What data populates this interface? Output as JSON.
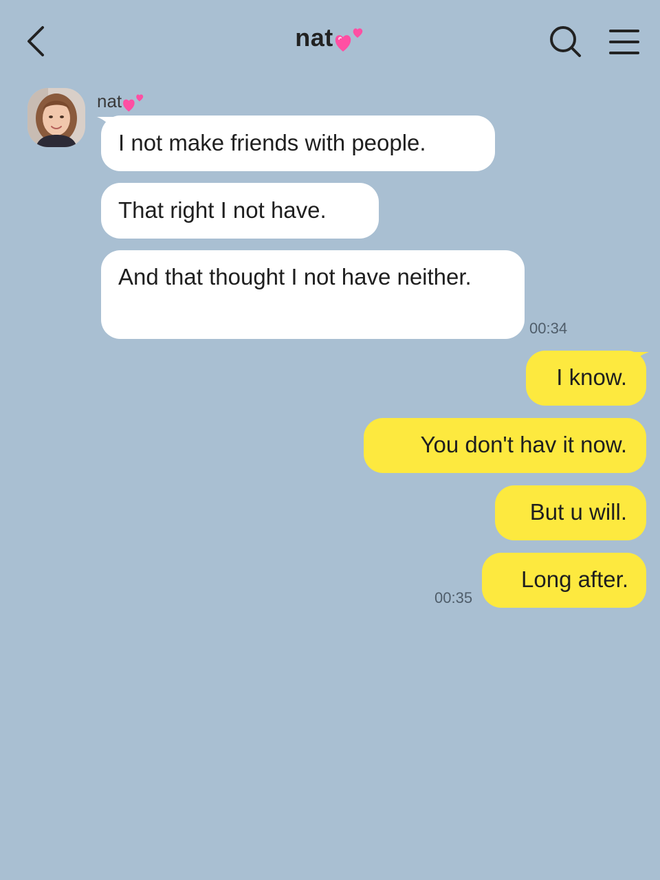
{
  "header": {
    "title": "nat",
    "title_emoji": "two-hearts-icon"
  },
  "contact": {
    "name": "nat",
    "name_emoji": "two-hearts-icon"
  },
  "messages": [
    {
      "direction": "incoming",
      "text": "I not make friends with people."
    },
    {
      "direction": "incoming",
      "text": "That right I not have."
    },
    {
      "direction": "incoming",
      "text": "And that thought I not have neither."
    },
    {
      "direction": "outgoing",
      "text": "I know."
    },
    {
      "direction": "outgoing",
      "text": "You don't hav it now."
    },
    {
      "direction": "outgoing",
      "text": "But u will."
    },
    {
      "direction": "outgoing",
      "text": "Long after."
    }
  ],
  "timestamps": {
    "incoming_group": "00:34",
    "outgoing_group": "00:35"
  },
  "colors": {
    "background": "#a9bfd2",
    "incoming_bubble": "#ffffff",
    "outgoing_bubble": "#fde93f",
    "heart": "#ff4fa3"
  }
}
